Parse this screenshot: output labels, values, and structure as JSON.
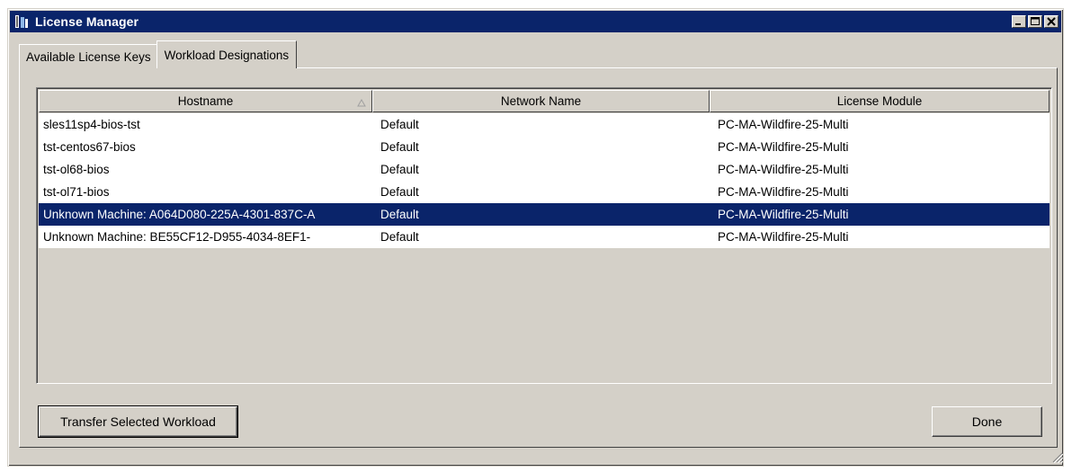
{
  "window": {
    "title": "License Manager"
  },
  "tabs": [
    {
      "label": "Available License Keys",
      "active": false
    },
    {
      "label": "Workload Designations",
      "active": true
    }
  ],
  "table": {
    "columns": [
      "Hostname",
      "Network Name",
      "License Module"
    ],
    "sorted_column": "Hostname",
    "rows": [
      {
        "hostname": "sles11sp4-bios-tst",
        "network": "Default",
        "module": "PC-MA-Wildfire-25-Multi"
      },
      {
        "hostname": "tst-centos67-bios",
        "network": "Default",
        "module": "PC-MA-Wildfire-25-Multi"
      },
      {
        "hostname": "tst-ol68-bios",
        "network": "Default",
        "module": "PC-MA-Wildfire-25-Multi"
      },
      {
        "hostname": "tst-ol71-bios",
        "network": "Default",
        "module": "PC-MA-Wildfire-25-Multi"
      },
      {
        "hostname": "Unknown Machine: A064D080-225A-4301-837C-A",
        "network": "Default",
        "module": "PC-MA-Wildfire-25-Multi"
      },
      {
        "hostname": "Unknown Machine: BE55CF12-D955-4034-8EF1-",
        "network": "Default",
        "module": "PC-MA-Wildfire-25-Multi"
      }
    ],
    "selected_row": 4
  },
  "buttons": {
    "transfer": "Transfer Selected Workload",
    "done": "Done"
  },
  "colors": {
    "titlebar": "#0a246a",
    "selection": "#0a246a",
    "face": "#d4d0c8"
  }
}
